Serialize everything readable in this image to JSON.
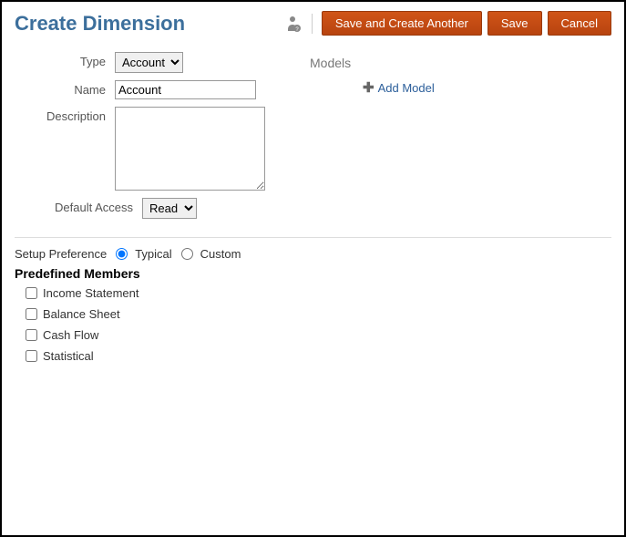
{
  "header": {
    "title": "Create Dimension",
    "save_create_another": "Save and Create Another",
    "save": "Save",
    "cancel": "Cancel"
  },
  "form": {
    "type_label": "Type",
    "type_value": "Account",
    "name_label": "Name",
    "name_value": "Account",
    "description_label": "Description",
    "description_value": "",
    "default_access_label": "Default Access",
    "default_access_value": "Read"
  },
  "models": {
    "label": "Models",
    "add_label": "Add Model"
  },
  "setup": {
    "label": "Setup Preference",
    "typical": "Typical",
    "custom": "Custom"
  },
  "predefined": {
    "title": "Predefined Members",
    "items": [
      "Income Statement",
      "Balance Sheet",
      "Cash Flow",
      "Statistical"
    ]
  }
}
